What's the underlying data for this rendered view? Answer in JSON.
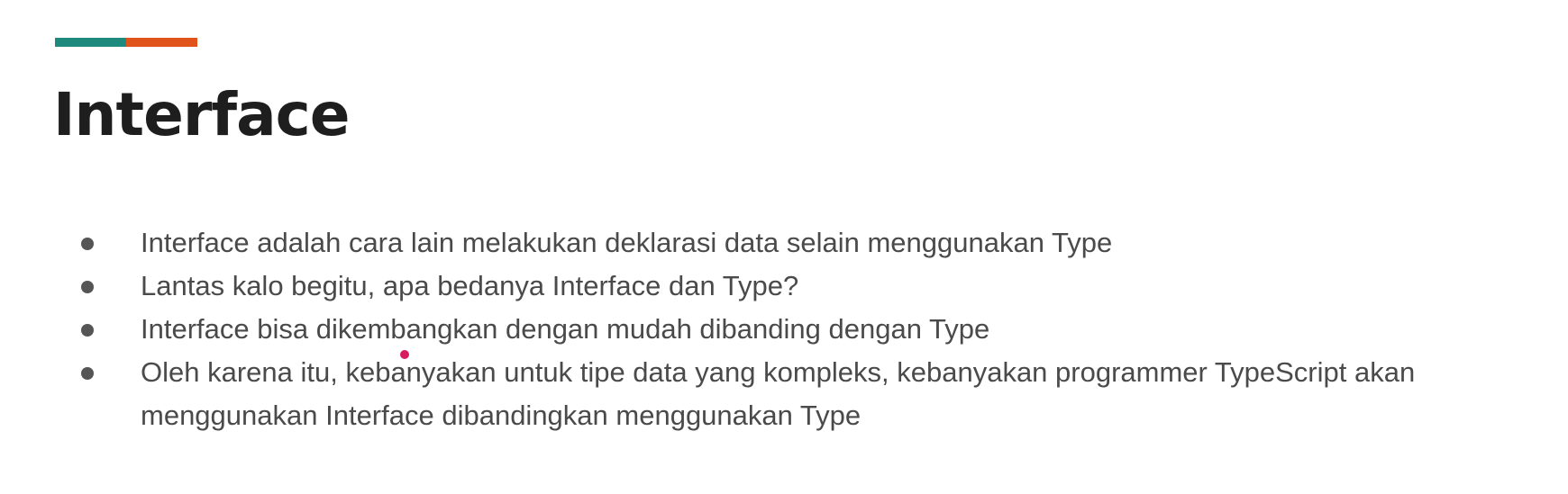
{
  "slide": {
    "title": "Interface",
    "accent_colors": {
      "teal": "#1e8a7e",
      "orange": "#e0531b"
    },
    "bullets": [
      {
        "text": "Interface adalah cara lain melakukan deklarasi data selain menggunakan Type"
      },
      {
        "text": "Lantas kalo begitu, apa bedanya Interface dan Type?"
      },
      {
        "text": "Interface bisa dikembangkan dengan mudah dibanding dengan Type"
      },
      {
        "text": "Oleh karena itu, kebanyakan untuk tipe data yang kompleks, kebanyakan programmer TypeScript akan menggunakan Interface dibandingkan menggunakan Type"
      }
    ]
  },
  "pointer": {
    "color": "#d81b60"
  }
}
